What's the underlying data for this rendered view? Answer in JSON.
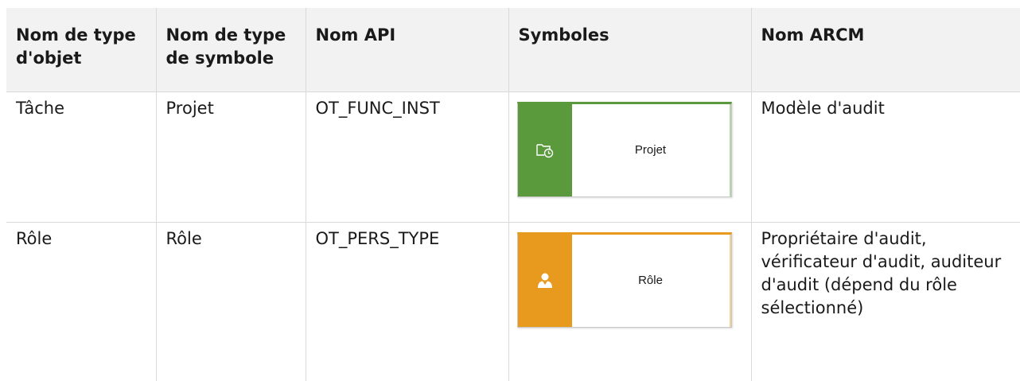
{
  "headers": [
    "Nom de type d'objet",
    "Nom de type de symbole",
    "Nom API",
    "Symboles",
    "Nom ARCM"
  ],
  "rows": [
    {
      "object_type": "Tâche",
      "symbol_type": "Projet",
      "api_name": "OT_FUNC_INST",
      "symbol_label": "Projet",
      "symbol_icon": "folder-clock-icon",
      "symbol_color": "#5a9a3c",
      "arcm_name": "Modèle d'audit"
    },
    {
      "object_type": "Rôle",
      "symbol_type": "Rôle",
      "api_name": "OT_PERS_TYPE",
      "symbol_label": "Rôle",
      "symbol_icon": "person-role-icon",
      "symbol_color": "#e89a1f",
      "arcm_name": "Propriétaire d'audit, vérificateur d'audit, auditeur d'audit (dépend du rôle sélectionné)"
    }
  ]
}
